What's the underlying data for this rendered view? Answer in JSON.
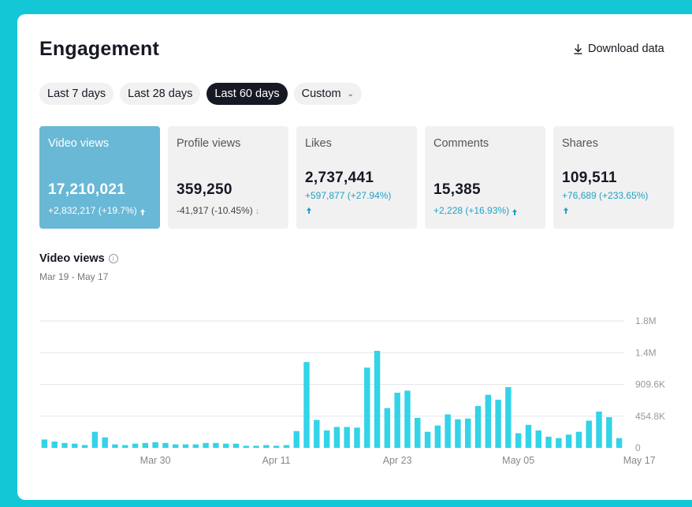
{
  "header": {
    "title": "Engagement",
    "download_label": "Download data"
  },
  "filters": [
    {
      "label": "Last 7 days",
      "active": false
    },
    {
      "label": "Last 28 days",
      "active": false
    },
    {
      "label": "Last 60 days",
      "active": true
    },
    {
      "label": "Custom",
      "active": false
    }
  ],
  "metrics": [
    {
      "label": "Video views",
      "value": "17,210,021",
      "change": "+2,832,217 (+19.7%)",
      "direction": "up"
    },
    {
      "label": "Profile views",
      "value": "359,250",
      "change": "-41,917 (-10.45%)",
      "direction": "down"
    },
    {
      "label": "Likes",
      "value": "2,737,441",
      "change": "+597,877 (+27.94%)",
      "direction": "up"
    },
    {
      "label": "Comments",
      "value": "15,385",
      "change": "+2,228 (+16.93%)",
      "direction": "up"
    },
    {
      "label": "Shares",
      "value": "109,511",
      "change": "+76,689 (+233.65%)",
      "direction": "up"
    }
  ],
  "chart": {
    "title": "Video views",
    "range": "Mar 19 - May 17"
  },
  "colors": {
    "accent": "#68b8d6",
    "bar": "#33d3e8",
    "positive": "#1fa2c2",
    "background": "#14c7d6"
  },
  "chart_data": {
    "type": "bar",
    "x_tick_labels": [
      "Mar 30",
      "Apr 11",
      "Apr 23",
      "May 05",
      "May 17"
    ],
    "x_tick_indices": [
      11,
      23,
      35,
      47,
      59
    ],
    "y_tick_labels": [
      "0",
      "454.8K",
      "909.6K",
      "1.4M",
      "1.8M"
    ],
    "y_tick_values": [
      0,
      454800,
      909600,
      1364400,
      1819200
    ],
    "ylim": [
      0,
      1819200
    ],
    "grid": true,
    "values": [
      120000,
      90000,
      70000,
      60000,
      40000,
      230000,
      150000,
      50000,
      40000,
      60000,
      70000,
      80000,
      70000,
      50000,
      50000,
      50000,
      70000,
      70000,
      60000,
      60000,
      30000,
      30000,
      40000,
      30000,
      40000,
      240000,
      1230000,
      400000,
      250000,
      300000,
      300000,
      290000,
      1150000,
      1390000,
      570000,
      790000,
      820000,
      430000,
      230000,
      320000,
      480000,
      410000,
      420000,
      600000,
      760000,
      690000,
      870000,
      210000,
      330000,
      250000,
      160000,
      140000,
      190000,
      230000,
      390000,
      520000,
      440000,
      140000
    ]
  }
}
